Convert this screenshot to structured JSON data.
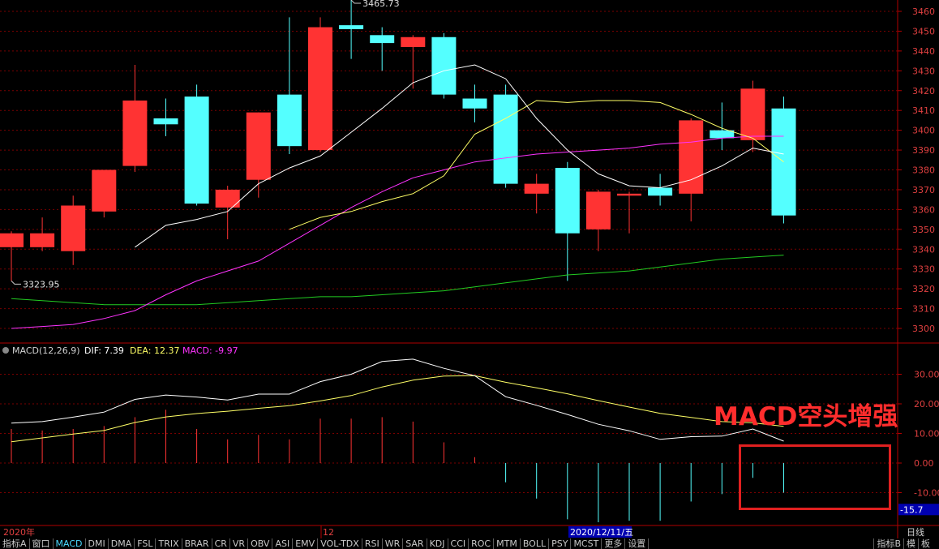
{
  "colors": {
    "up": "#ff3333",
    "down": "#54ffff",
    "ma5": "#ffffff",
    "ma10": "#ffff66",
    "ma20": "#ff33ff",
    "ma60": "#22cc22",
    "grid": "#7a0000",
    "axis_text": "#e04040",
    "dif": "#ffffff",
    "dea": "#ffff66"
  },
  "chart_data": [
    {
      "type": "candlestick",
      "y_ticks": [
        "3460",
        "3450",
        "3440",
        "3430",
        "3420",
        "3410",
        "3400",
        "3390",
        "3380",
        "3370",
        "3360",
        "3350",
        "3340",
        "3330",
        "3320",
        "3310",
        "3300"
      ],
      "ylim": [
        3296,
        3463
      ],
      "high_label": "3465.73",
      "low_label": "3323.95",
      "candles": [
        {
          "o": 3341,
          "c": 3348,
          "h": 3349,
          "l": 3324
        },
        {
          "o": 3341,
          "c": 3348,
          "h": 3356,
          "l": 3339
        },
        {
          "o": 3339,
          "c": 3362,
          "h": 3367,
          "l": 3332
        },
        {
          "o": 3359,
          "c": 3380,
          "h": 3380,
          "l": 3356
        },
        {
          "o": 3382,
          "c": 3415,
          "h": 3433,
          "l": 3379
        },
        {
          "o": 3406,
          "c": 3403,
          "h": 3416,
          "l": 3397
        },
        {
          "o": 3417,
          "c": 3363,
          "h": 3423,
          "l": 3362
        },
        {
          "o": 3361,
          "c": 3370,
          "h": 3372,
          "l": 3345
        },
        {
          "o": 3375,
          "c": 3409,
          "h": 3409,
          "l": 3366
        },
        {
          "o": 3418,
          "c": 3392,
          "h": 3457,
          "l": 3388
        },
        {
          "o": 3390,
          "c": 3452,
          "h": 3457,
          "l": 3389
        },
        {
          "o": 3453,
          "c": 3451,
          "h": 3465.73,
          "l": 3436
        },
        {
          "o": 3448,
          "c": 3444,
          "h": 3452,
          "l": 3430
        },
        {
          "o": 3442,
          "c": 3447,
          "h": 3448,
          "l": 3421
        },
        {
          "o": 3447,
          "c": 3418,
          "h": 3449,
          "l": 3416
        },
        {
          "o": 3416,
          "c": 3411,
          "h": 3423,
          "l": 3404
        },
        {
          "o": 3418,
          "c": 3373,
          "h": 3423,
          "l": 3371
        },
        {
          "o": 3368,
          "c": 3373,
          "h": 3378,
          "l": 3358
        },
        {
          "o": 3381,
          "c": 3348,
          "h": 3384,
          "l": 3324
        },
        {
          "o": 3350,
          "c": 3369,
          "h": 3370,
          "l": 3339
        },
        {
          "o": 3367,
          "c": 3368,
          "h": 3369,
          "l": 3348
        },
        {
          "o": 3371,
          "c": 3367,
          "h": 3378,
          "l": 3362
        },
        {
          "o": 3368,
          "c": 3405,
          "h": 3406,
          "l": 3354
        },
        {
          "o": 3400,
          "c": 3396,
          "h": 3414,
          "l": 3390
        },
        {
          "o": 3395,
          "c": 3421,
          "h": 3425,
          "l": 3389
        },
        {
          "o": 3411,
          "c": 3357,
          "h": 3417,
          "l": 3353
        }
      ],
      "ma5": [
        null,
        null,
        null,
        null,
        3341,
        3352,
        3355,
        3359,
        3373,
        3381,
        3387,
        3399,
        3411,
        3424,
        3430,
        3433,
        3426,
        3406,
        3390,
        3378,
        3372,
        3371,
        3375,
        3382,
        3391,
        3388
      ],
      "ma10": [
        null,
        null,
        null,
        null,
        null,
        null,
        null,
        null,
        null,
        3350,
        3356,
        3359,
        3364,
        3368,
        3377,
        3398,
        3406,
        3415,
        3414,
        3415,
        3415,
        3414,
        3408,
        3401,
        3396,
        3384
      ],
      "ma20": [
        3300,
        3301,
        3302,
        3305,
        3309,
        3317,
        3324,
        3329,
        3334,
        3343,
        3352,
        3361,
        3369,
        3376,
        3380,
        3384,
        3386,
        3388,
        3389,
        3390,
        3391,
        3393,
        3394,
        3396,
        3397,
        3397
      ],
      "ma60": [
        3315,
        3314,
        3313,
        3312,
        3312,
        3312,
        3312,
        3313,
        3314,
        3315,
        3316,
        3316,
        3317,
        3318,
        3319,
        3321,
        3323,
        3325,
        3327,
        3328,
        3329,
        3331,
        3333,
        3335,
        3336,
        3337
      ]
    },
    {
      "type": "macd",
      "title": "MACD(12,26,9)",
      "dif_label": "DIF: 7.39",
      "dea_label": "DEA: 12.37",
      "macd_label": "MACD: -9.97",
      "y_ticks": [
        "30.00",
        "20.00",
        "10.00",
        "0.00",
        "-10.00"
      ],
      "current_value": "-15.7",
      "ylim": [
        -20,
        39
      ],
      "dif": [
        13.5,
        14.0,
        15.5,
        17.2,
        21.5,
        23.0,
        22.3,
        21.3,
        23.3,
        23.3,
        27.5,
        30.0,
        34.3,
        35.1,
        32.0,
        29.5,
        22.4,
        19.5,
        16.4,
        13.1,
        10.9,
        8.0,
        8.9,
        9.1,
        11.5,
        7.4
      ],
      "dea": [
        7.2,
        8.5,
        9.8,
        11.0,
        13.7,
        15.6,
        16.7,
        17.5,
        18.5,
        19.4,
        21.0,
        22.8,
        25.7,
        28.0,
        29.4,
        29.5,
        27.3,
        25.4,
        23.4,
        21.1,
        18.9,
        16.8,
        15.4,
        14.0,
        13.6,
        12.4
      ],
      "macd": [
        11.5,
        11.0,
        11.5,
        12.5,
        15.5,
        18.0,
        11.5,
        8.0,
        9.5,
        8.0,
        15.0,
        15.0,
        15.5,
        14.0,
        7.0,
        2.0,
        -6.5,
        -12.0,
        -19.0,
        -20.0,
        -19.5,
        -19.5,
        -13.0,
        -10.5,
        -5.0,
        -10.0
      ]
    }
  ],
  "axis": {
    "date_start": "2020年",
    "date_mid": "12",
    "date_current": "2020/12/11/五"
  },
  "annotation": {
    "text": "MACD空头增强"
  },
  "toolbar": {
    "items": [
      "指标A",
      "窗口",
      "MACD",
      "DMI",
      "DMA",
      "FSL",
      "TRIX",
      "BRAR",
      "CR",
      "VR",
      "OBV",
      "ASI",
      "EMV",
      "VOL-TDX",
      "RSI",
      "WR",
      "SAR",
      "KDJ",
      "CCI",
      "ROC",
      "MTM",
      "BOLL",
      "PSY",
      "MCST",
      "更多",
      "设置"
    ],
    "right_items": [
      "指标B",
      "模",
      "板"
    ],
    "period": "日线"
  }
}
